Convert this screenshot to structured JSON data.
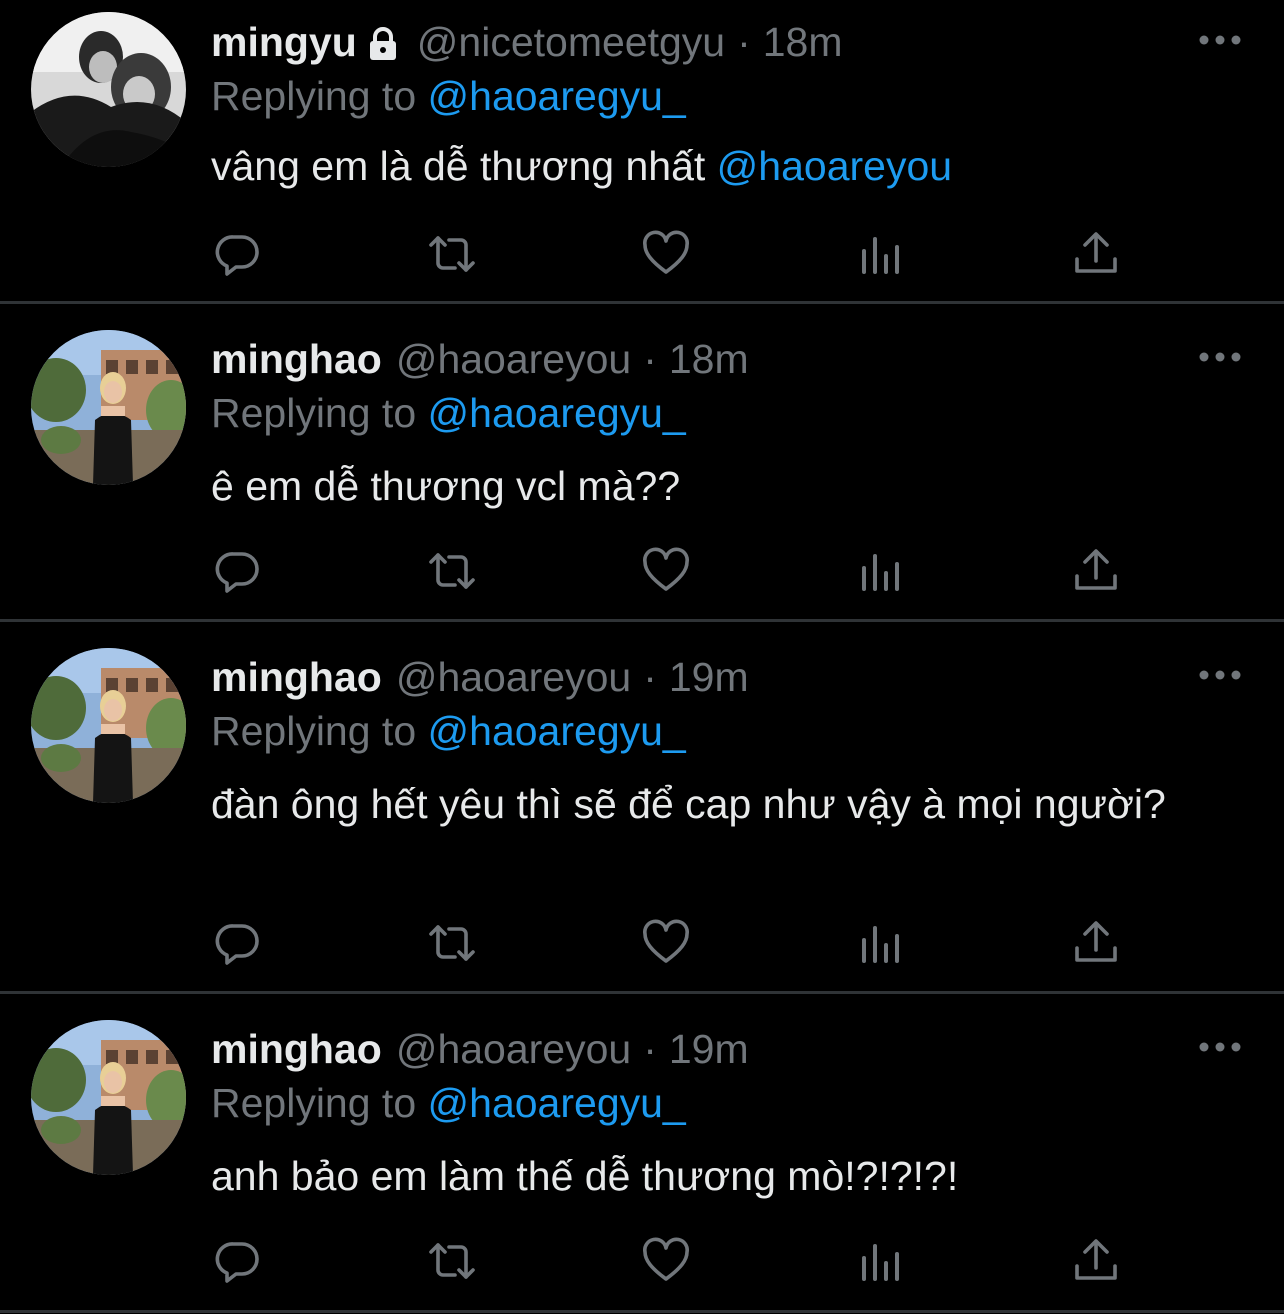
{
  "tweets": [
    {
      "name": "mingyu",
      "protected": true,
      "handle": "@nicetomeetgyu",
      "separator": "·",
      "time": "18m",
      "replying_prefix": "Replying to",
      "replying_to": "@haoaregyu_",
      "text": "vâng em là dễ thương nhất",
      "text_mention": "@haoareyou"
    },
    {
      "name": "minghao",
      "protected": false,
      "handle": "@haoareyou",
      "separator": "·",
      "time": "18m",
      "replying_prefix": "Replying to",
      "replying_to": "@haoaregyu_",
      "text": "ê em dễ thương vcl mà??",
      "text_mention": ""
    },
    {
      "name": "minghao",
      "protected": false,
      "handle": "@haoareyou",
      "separator": "·",
      "time": "19m",
      "replying_prefix": "Replying to",
      "replying_to": "@haoaregyu_",
      "text": "đàn ông hết yêu thì sẽ để cap như vậy à mọi người?",
      "text_mention": ""
    },
    {
      "name": "minghao",
      "protected": false,
      "handle": "@haoareyou",
      "separator": "·",
      "time": "19m",
      "replying_prefix": "Replying to",
      "replying_to": "@haoaregyu_",
      "text": "anh bảo em làm thế dễ thương mò!?!?!?!",
      "text_mention": ""
    }
  ],
  "icons": {
    "reply": "reply-icon",
    "retweet": "retweet-icon",
    "like": "heart-icon",
    "analytics": "analytics-icon",
    "share": "share-icon",
    "more": "more-icon",
    "lock": "lock-icon"
  },
  "colors": {
    "background": "#000000",
    "text": "#e7e9ea",
    "secondary": "#71767b",
    "accent": "#1d9bf0",
    "divider": "#2f3336"
  }
}
